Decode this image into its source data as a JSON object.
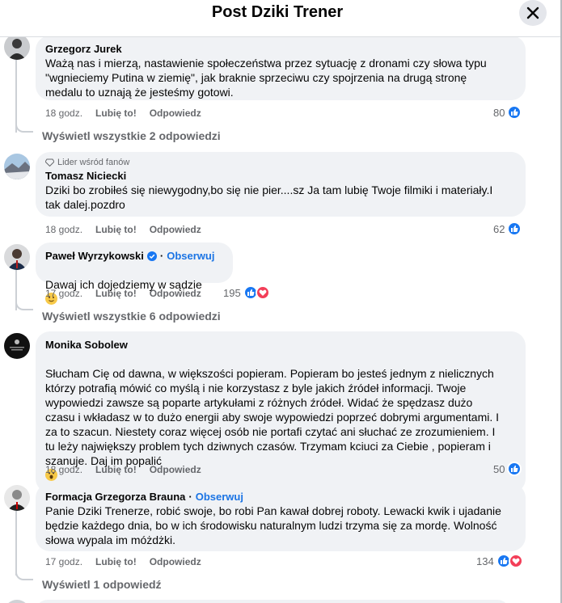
{
  "header": {
    "title": "Post Dziki Trener"
  },
  "comments": [
    {
      "author": "Grzegorz Jurek",
      "text": "Ważą nas i mierzą, nastawienie społeczeństwa przez sytuację z dronami czy słowa typu\n\"wgnieciemy Putina w ziemię\", jak braknie sprzeciwu czy spojrzenia na drugą stronę\nmedalu to uznają że jesteśmy gotowi.",
      "time": "18 godz.",
      "like": "Lubię to!",
      "reply": "Odpowiedz",
      "count": "80",
      "view_replies": "Wyświetl wszystkie 2 odpowiedzi"
    },
    {
      "badge": "Lider wśród fanów",
      "author": "Tomasz Niciecki",
      "text": "Dziki bo zrobiłeś się niewygodny,bo się nie pier....sz Ja tam lubię Twoje filmiki i materiały.I\ntak dalej.pozdro",
      "time": "18 godz.",
      "like": "Lubię to!",
      "reply": "Odpowiedz",
      "count": "62"
    },
    {
      "author": "Paweł Wyrzykowski",
      "follow": "Obserwuj",
      "text": "Dawaj ich dojedziemy w sądzie",
      "time": "17 godz.",
      "like": "Lubię to!",
      "reply": "Odpowiedz",
      "count": "195",
      "view_replies": "Wyświetl wszystkie 6 odpowiedzi"
    },
    {
      "author": "Monika Sobolew",
      "text": "Słucham Cię od dawna, w większości popieram. Popieram bo jesteś jednym z nielicznych\nktórzy potrafią mówić co myślą i nie korzystasz z byle jakich źródeł informacji. Twoje\nwypowiedzi zawsze są poparte artykułami z różnych źródeł. Widać że spędzasz dużo\nczasu i wkładasz w to dużo energii aby swoje wypowiedzi poprzeć dobrymi argumentami. I\nza to szacun. Niestety coraz więcej osób nie portafi czytać ani słuchać ze zrozumieniem. I\ntu leży największy problem tych dziwnych czasów. Trzymam kciuci za Ciebie , popieram i\nszanuje. Daj im popalić",
      "time": "18 godz.",
      "like": "Lubię to!",
      "reply": "Odpowiedz",
      "count": "50"
    },
    {
      "author": "Formacja Grzegorza Brauna",
      "follow": "Obserwuj",
      "text": "Panie Dziki Trenerze, robić swoje, bo robi Pan kawał dobrej roboty. Lewacki kwik i ujadanie\nbędzie każdego dnia, bo w ich środowisku naturalnym ludzi trzyma się za mordę. Wolność\nsłowa wypala im móżdżki.",
      "time": "17 godz.",
      "like": "Lubię to!",
      "reply": "Odpowiedz",
      "count": "134",
      "view_replies": "Wyświetl 1 odpowiedź"
    }
  ],
  "colors": {
    "link": "#1b74e4",
    "like": "#1877f2",
    "love": "#f33e58",
    "bubble": "#f0f2f5",
    "muted": "#65676b"
  },
  "icons": {
    "close": "close-icon",
    "like": "like-reaction-icon",
    "love": "love-reaction-icon",
    "verified": "verified-badge-icon",
    "fan": "diamond-icon"
  }
}
